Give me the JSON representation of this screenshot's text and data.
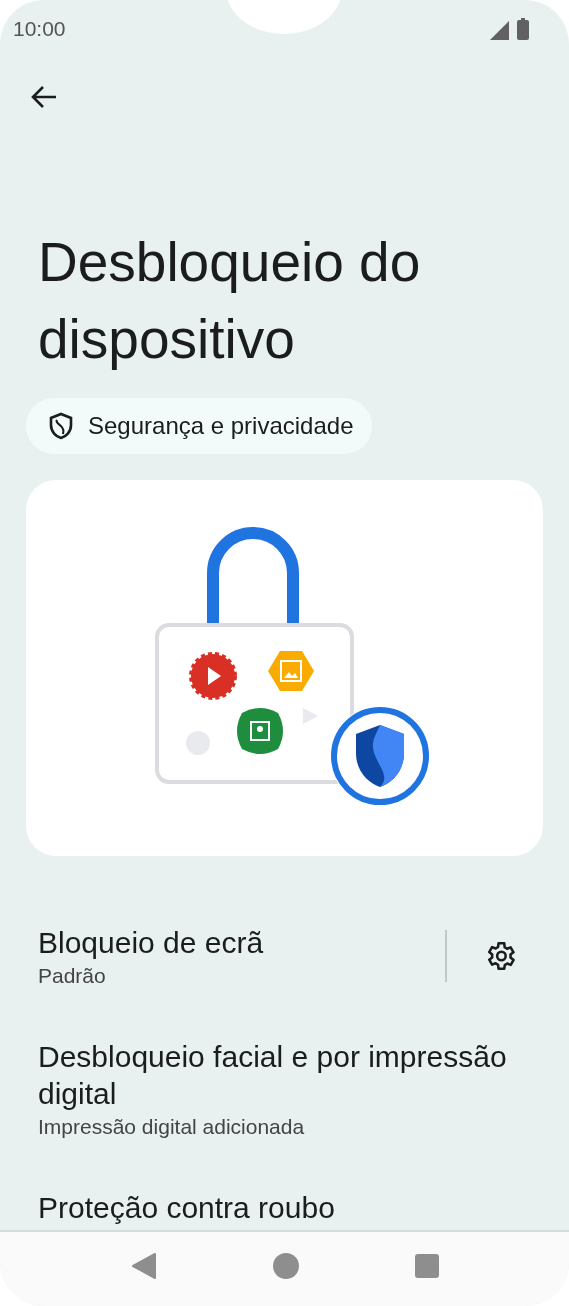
{
  "status_bar": {
    "time": "10:00"
  },
  "title": "Desbloqueio do dispositivo",
  "breadcrumb": "Segurança e privacidade",
  "settings": [
    {
      "kind": "with_gear",
      "title": "Bloqueio de ecrã",
      "summary": "Padrão"
    },
    {
      "kind": "plain",
      "title": "Desbloqueio facial e por impressão digital",
      "summary": "Impressão digital adicionada"
    },
    {
      "kind": "plain",
      "title": "Proteção contra roubo"
    }
  ]
}
